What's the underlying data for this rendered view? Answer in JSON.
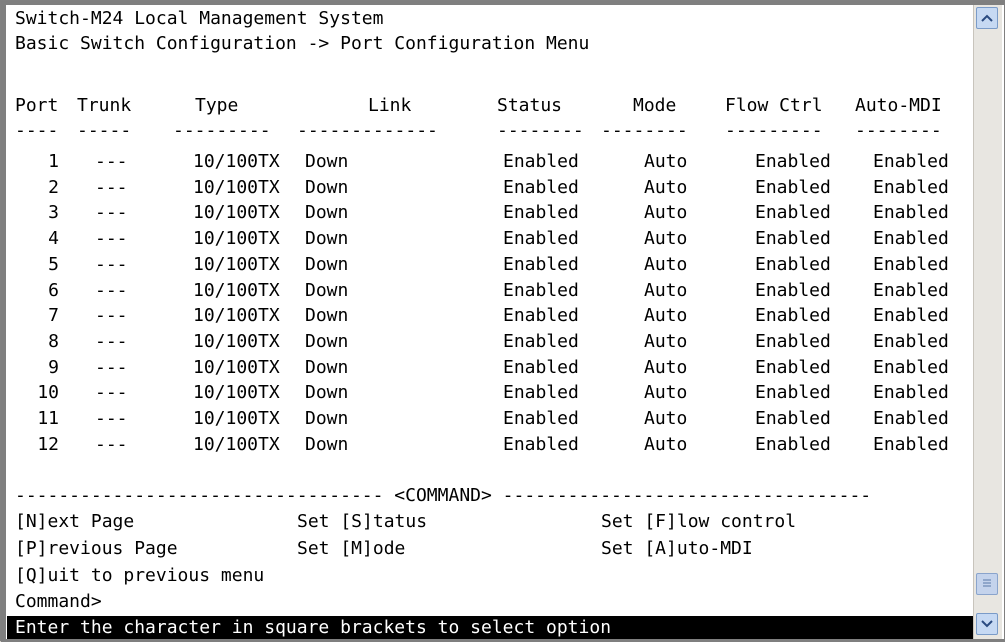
{
  "title_line1": "Switch-M24 Local Management System",
  "title_line2": "Basic Switch Configuration -> Port Configuration Menu",
  "columns": {
    "port": "Port",
    "trunk": "Trunk",
    "type": "Type",
    "link": "Link",
    "status": "Status",
    "mode": "Mode",
    "flow": "Flow Ctrl",
    "mdi": "Auto-MDI"
  },
  "separators": {
    "port": "----",
    "trunk": "-----",
    "type": "---------",
    "link": "-------------",
    "status": "--------",
    "mode": "--------",
    "flow": "---------",
    "mdi": "--------"
  },
  "rows": [
    {
      "port": "1",
      "trunk": "---",
      "type": "10/100TX",
      "link": "Down",
      "status": "Enabled",
      "mode": "Auto",
      "flow": "Enabled",
      "mdi": "Enabled"
    },
    {
      "port": "2",
      "trunk": "---",
      "type": "10/100TX",
      "link": "Down",
      "status": "Enabled",
      "mode": "Auto",
      "flow": "Enabled",
      "mdi": "Enabled"
    },
    {
      "port": "3",
      "trunk": "---",
      "type": "10/100TX",
      "link": "Down",
      "status": "Enabled",
      "mode": "Auto",
      "flow": "Enabled",
      "mdi": "Enabled"
    },
    {
      "port": "4",
      "trunk": "---",
      "type": "10/100TX",
      "link": "Down",
      "status": "Enabled",
      "mode": "Auto",
      "flow": "Enabled",
      "mdi": "Enabled"
    },
    {
      "port": "5",
      "trunk": "---",
      "type": "10/100TX",
      "link": "Down",
      "status": "Enabled",
      "mode": "Auto",
      "flow": "Enabled",
      "mdi": "Enabled"
    },
    {
      "port": "6",
      "trunk": "---",
      "type": "10/100TX",
      "link": "Down",
      "status": "Enabled",
      "mode": "Auto",
      "flow": "Enabled",
      "mdi": "Enabled"
    },
    {
      "port": "7",
      "trunk": "---",
      "type": "10/100TX",
      "link": "Down",
      "status": "Enabled",
      "mode": "Auto",
      "flow": "Enabled",
      "mdi": "Enabled"
    },
    {
      "port": "8",
      "trunk": "---",
      "type": "10/100TX",
      "link": "Down",
      "status": "Enabled",
      "mode": "Auto",
      "flow": "Enabled",
      "mdi": "Enabled"
    },
    {
      "port": "9",
      "trunk": "---",
      "type": "10/100TX",
      "link": "Down",
      "status": "Enabled",
      "mode": "Auto",
      "flow": "Enabled",
      "mdi": "Enabled"
    },
    {
      "port": "10",
      "trunk": "---",
      "type": "10/100TX",
      "link": "Down",
      "status": "Enabled",
      "mode": "Auto",
      "flow": "Enabled",
      "mdi": "Enabled"
    },
    {
      "port": "11",
      "trunk": "---",
      "type": "10/100TX",
      "link": "Down",
      "status": "Enabled",
      "mode": "Auto",
      "flow": "Enabled",
      "mdi": "Enabled"
    },
    {
      "port": "12",
      "trunk": "---",
      "type": "10/100TX",
      "link": "Down",
      "status": "Enabled",
      "mode": "Auto",
      "flow": "Enabled",
      "mdi": "Enabled"
    }
  ],
  "command_divider": "---------------------------------- <COMMAND> ----------------------------------",
  "commands": {
    "next_page": "[N]ext Page",
    "set_status": "Set [S]tatus",
    "set_flow": "Set [F]low control",
    "previous_page": "[P]revious Page",
    "set_mode": "Set [M]ode",
    "set_mdi": "Set [A]uto-MDI",
    "quit": "[Q]uit to previous menu"
  },
  "prompt": "Command>",
  "status_message": "Enter the character in square brackets to select option",
  "icons": {
    "scroll_up": "arrow-up-icon",
    "scroll_down": "arrow-down-icon",
    "scroll_thumb": "grip-icon"
  },
  "colors": {
    "terminal_bg": "#ffffff",
    "terminal_fg": "#000000",
    "status_bar_bg": "#000000",
    "status_bar_fg": "#ffffff",
    "scroll_button": "#c6d9f3",
    "frame": "#7f7f7f"
  }
}
